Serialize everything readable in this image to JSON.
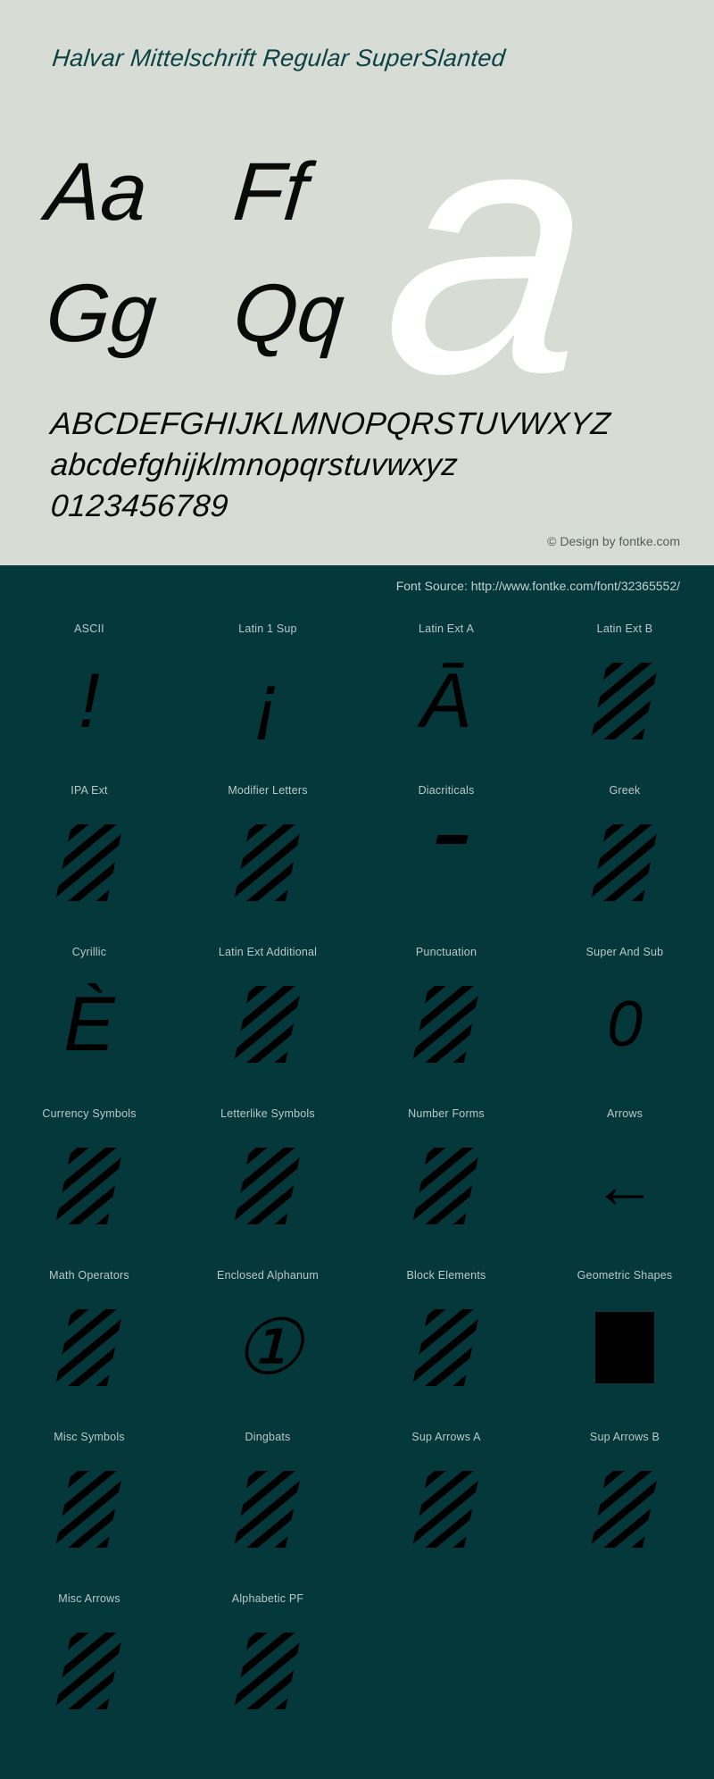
{
  "specimen": {
    "title": "Halvar Mittelschrift Regular SuperSlanted",
    "watermark_glyph": "a",
    "sample_pairs": [
      "Aa",
      "Ff",
      "Gg",
      "Qq"
    ],
    "uppercase": "ABCDEFGHIJKLMNOPQRSTUVWXYZ",
    "lowercase": "abcdefghijklmnopqrstuvwxyz",
    "digits": "0123456789",
    "design_credit": "© Design by fontke.com",
    "font_source": "Font Source: http://www.fontke.com/font/32365552/"
  },
  "colors": {
    "light_background": "#d7ddd5",
    "dark_background": "#04383a",
    "title_text": "#0c4246",
    "sample_text": "#0a0a0a",
    "watermark": "#ffffff",
    "label_text": "#bcc8c7",
    "credit_text": "#555c5a",
    "glyph_text": "#000000"
  },
  "unicode_blocks": [
    {
      "label": "ASCII",
      "glyph": "!",
      "kind": "glyph"
    },
    {
      "label": "Latin 1 Sup",
      "glyph": "¡",
      "kind": "glyph"
    },
    {
      "label": "Latin Ext A",
      "glyph": "Ā",
      "kind": "glyph"
    },
    {
      "label": "Latin Ext B",
      "glyph": "",
      "kind": "hatch"
    },
    {
      "label": "IPA Ext",
      "glyph": "",
      "kind": "hatch"
    },
    {
      "label": "Modifier Letters",
      "glyph": "",
      "kind": "hatch"
    },
    {
      "label": "Diacriticals",
      "glyph": "̄",
      "kind": "dash"
    },
    {
      "label": "Greek",
      "glyph": "",
      "kind": "hatch"
    },
    {
      "label": "Cyrillic",
      "glyph": "Ѐ",
      "kind": "glyph"
    },
    {
      "label": "Latin Ext Additional",
      "glyph": "",
      "kind": "hatch"
    },
    {
      "label": "Punctuation",
      "glyph": "",
      "kind": "hatch"
    },
    {
      "label": "Super And Sub",
      "glyph": "0",
      "kind": "small"
    },
    {
      "label": "Currency Symbols",
      "glyph": "",
      "kind": "hatch"
    },
    {
      "label": "Letterlike Symbols",
      "glyph": "",
      "kind": "hatch"
    },
    {
      "label": "Number Forms",
      "glyph": "",
      "kind": "hatch"
    },
    {
      "label": "Arrows",
      "glyph": "←",
      "kind": "small"
    },
    {
      "label": "Math Operators",
      "glyph": "",
      "kind": "hatch"
    },
    {
      "label": "Enclosed Alphanum",
      "glyph": "①",
      "kind": "glyph"
    },
    {
      "label": "Block Elements",
      "glyph": "",
      "kind": "hatch"
    },
    {
      "label": "Geometric Shapes",
      "glyph": "",
      "kind": "solid"
    },
    {
      "label": "Misc Symbols",
      "glyph": "",
      "kind": "hatch"
    },
    {
      "label": "Dingbats",
      "glyph": "",
      "kind": "hatch"
    },
    {
      "label": "Sup Arrows A",
      "glyph": "",
      "kind": "hatch"
    },
    {
      "label": "Sup Arrows B",
      "glyph": "",
      "kind": "hatch"
    },
    {
      "label": "Misc Arrows",
      "glyph": "",
      "kind": "hatch"
    },
    {
      "label": "Alphabetic PF",
      "glyph": "",
      "kind": "hatch"
    },
    {
      "label": "",
      "glyph": "",
      "kind": "empty"
    },
    {
      "label": "",
      "glyph": "",
      "kind": "empty"
    }
  ]
}
